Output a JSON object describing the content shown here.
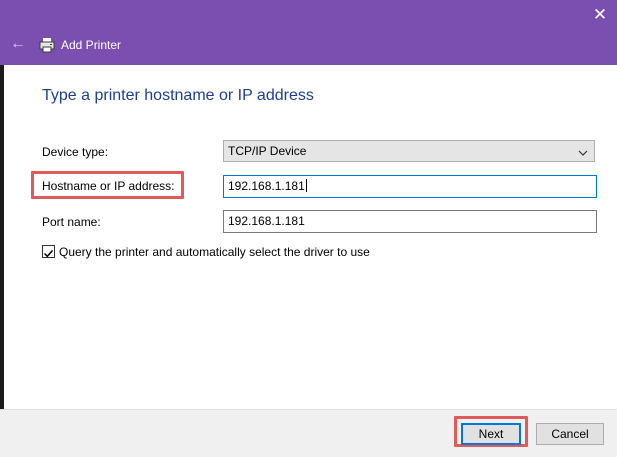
{
  "window": {
    "title": "Add Printer",
    "close_glyph": "✕",
    "back_glyph": "←"
  },
  "content": {
    "heading": "Type a printer hostname or IP address",
    "device_type": {
      "label": "Device type:",
      "value": "TCP/IP Device"
    },
    "hostname": {
      "label": "Hostname or IP address:",
      "value": "192.168.1.181"
    },
    "port": {
      "label": "Port name:",
      "value": "192.168.1.181"
    },
    "query_checkbox": {
      "label": "Query the printer and automatically select the driver to use",
      "checked": true
    }
  },
  "footer": {
    "next_label": "Next",
    "cancel_label": "Cancel"
  },
  "colors": {
    "titlebar": "#7b4fb0",
    "heading": "#1f3f8f",
    "highlight": "#e05a5a",
    "focus": "#0078d7"
  },
  "icons": [
    "close-icon",
    "back-arrow-icon",
    "printer-icon",
    "chevron-down-icon",
    "checkmark-icon"
  ]
}
